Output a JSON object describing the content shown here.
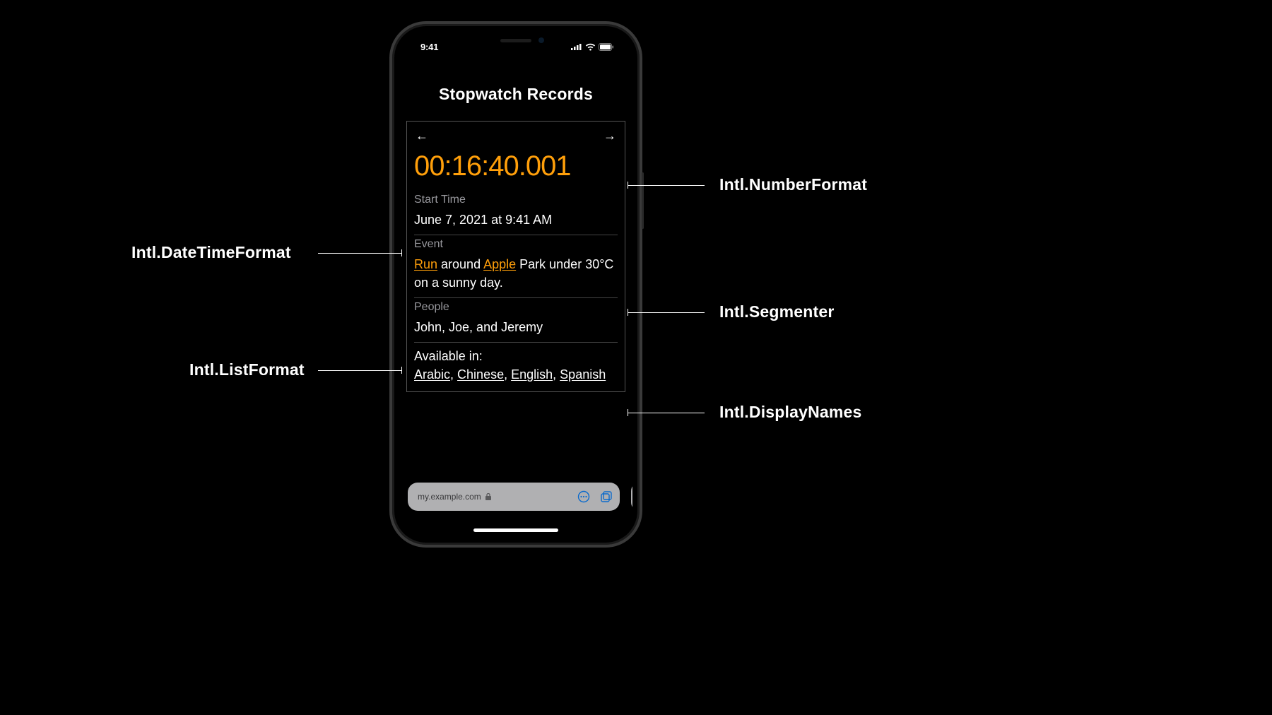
{
  "status": {
    "time": "9:41"
  },
  "page": {
    "title": "Stopwatch Records"
  },
  "record": {
    "timer": "00:16:40.001",
    "start_label": "Start Time",
    "start_value": "June 7, 2021 at 9:41 AM",
    "event_label": "Event",
    "event_parts": {
      "hl1": "Run",
      "mid1": " around ",
      "hl2": "Apple",
      "rest": " Park under 30°C on a sunny day."
    },
    "people_label": "People",
    "people_value": "John, Joe, and Jeremy",
    "available_label": "Available in:",
    "langs": {
      "a": "Arabic",
      "b": "Chinese",
      "c": "English",
      "d": "Spanish"
    }
  },
  "url": {
    "host": "my.example.com"
  },
  "annotations": {
    "numberformat": "Intl.NumberFormat",
    "datetimeformat": "Intl.DateTimeFormat",
    "segmenter": "Intl.Segmenter",
    "listformat": "Intl.ListFormat",
    "displaynames": "Intl.DisplayNames"
  }
}
